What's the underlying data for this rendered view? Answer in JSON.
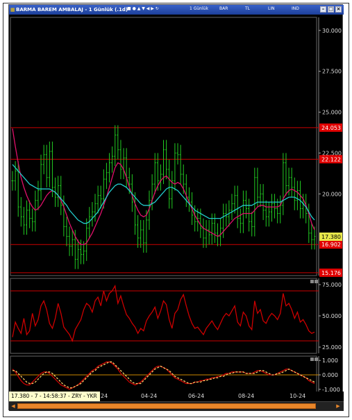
{
  "window": {
    "title": "BARMA BAREM AMBALAJ - 1 Günlük (.1d)",
    "toolbar_items": [
      "1 Günlük",
      "BAR",
      "TL",
      "LIN",
      "IND"
    ]
  },
  "status": {
    "text": "17.380 - 7 - 14:58:37 - ZRY - YKR",
    "x_ticks": [
      "24",
      "04-24",
      "06-24",
      "08-24",
      "10-24"
    ]
  },
  "colors": {
    "background": "#000000",
    "candle": "#22cc22",
    "ma_fast": "#e0106a",
    "ma_slow": "#22cccc",
    "hline": "#cc0000",
    "rsi": "#cc0000",
    "macd": "#cc0000",
    "signal": "#ffcc66",
    "last_price_bg": "#e8e84a"
  },
  "chart_data": [
    {
      "type": "line",
      "panel": "price",
      "ylim": [
        15.0,
        30.8
      ],
      "y_ticks": [
        "30.000",
        "27.500",
        "25.000",
        "22.500",
        "20.000"
      ],
      "horizontal_levels": [
        {
          "label": "24.053",
          "value": 24.053
        },
        {
          "label": "22.122",
          "value": 22.122
        },
        {
          "label": "16.902",
          "value": 16.902
        },
        {
          "label": "15.176",
          "value": 15.176
        }
      ],
      "last_price": {
        "label": "17.380",
        "value": 17.38
      },
      "candles": {
        "x": [
          0,
          4,
          8,
          12,
          16,
          20,
          24,
          28,
          32,
          36,
          40,
          44,
          48,
          52,
          56,
          60,
          64,
          68,
          72,
          76,
          80,
          84,
          88,
          92,
          96,
          100,
          104,
          108,
          112,
          116,
          120,
          124,
          128,
          132,
          136,
          140,
          144,
          148,
          152,
          156,
          160,
          164,
          168,
          172,
          176,
          180,
          184,
          188,
          192,
          196,
          200,
          204,
          208,
          212,
          216,
          220,
          224,
          228,
          232,
          236,
          240,
          244,
          248,
          252,
          256,
          260,
          264,
          268,
          272,
          276,
          280,
          284,
          288,
          292,
          296,
          300,
          304,
          308,
          312,
          316,
          320,
          324,
          328,
          332,
          336,
          340,
          344,
          348,
          352,
          356,
          360,
          364,
          368,
          372,
          376,
          380,
          384,
          388,
          392,
          396,
          400,
          404,
          408,
          412,
          416,
          420,
          424
        ],
        "close": [
          20.8,
          21.4,
          19.2,
          18.6,
          18.1,
          19.0,
          18.5,
          18.3,
          19.6,
          20.2,
          21.8,
          22.4,
          21.0,
          22.6,
          20.4,
          19.8,
          20.5,
          19.3,
          18.0,
          17.4,
          16.8,
          17.2,
          16.0,
          16.6,
          16.3,
          16.5,
          17.9,
          18.6,
          18.9,
          19.4,
          19.9,
          19.7,
          20.9,
          21.3,
          21.9,
          22.3,
          23.6,
          22.7,
          21.5,
          22.2,
          21.0,
          20.6,
          19.5,
          18.1,
          17.3,
          17.8,
          17.0,
          18.4,
          19.6,
          20.6,
          21.9,
          20.8,
          21.2,
          22.7,
          21.5,
          19.7,
          20.8,
          22.5,
          22.4,
          21.2,
          20.6,
          19.8,
          19.5,
          18.7,
          18.3,
          18.5,
          17.9,
          17.3,
          17.8,
          17.5,
          18.2,
          17.6,
          17.4,
          17.9,
          18.8,
          18.6,
          19.0,
          19.4,
          19.9,
          18.5,
          18.2,
          19.6,
          19.1,
          18.3,
          18.0,
          21.0,
          19.8,
          20.0,
          19.0,
          18.6,
          18.9,
          19.4,
          19.1,
          18.8,
          19.3,
          21.9,
          20.5,
          21.0,
          20.4,
          19.6,
          20.2,
          19.1,
          19.4,
          18.8,
          17.6,
          17.2,
          17.4
        ],
        "amplitude": 0.6
      },
      "series": [
        {
          "role": "ma_fast",
          "values": [
            24.0,
            22.9,
            21.9,
            21.0,
            20.4,
            19.9,
            19.5,
            19.2,
            19.0,
            19.1,
            19.3,
            19.6,
            19.9,
            20.1,
            20.2,
            20.1,
            19.9,
            19.6,
            19.2,
            18.7,
            18.2,
            17.8,
            17.4,
            17.1,
            16.9,
            16.9,
            17.0,
            17.3,
            17.6,
            18.0,
            18.4,
            18.8,
            19.3,
            19.8,
            20.4,
            21.0,
            21.6,
            21.9,
            21.8,
            21.5,
            21.0,
            20.4,
            19.9,
            19.4,
            19.0,
            18.7,
            18.6,
            18.7,
            19.1,
            19.6,
            20.1,
            20.5,
            20.8,
            21.0,
            21.1,
            20.9,
            20.7,
            20.6,
            20.7,
            20.6,
            20.3,
            19.9,
            19.5,
            19.1,
            18.7,
            18.4,
            18.1,
            17.9,
            17.8,
            17.7,
            17.6,
            17.5,
            17.4,
            17.5,
            17.7,
            17.9,
            18.1,
            18.3,
            18.5,
            18.6,
            18.7,
            18.8,
            18.8,
            18.8,
            18.8,
            19.0,
            19.2,
            19.3,
            19.3,
            19.2,
            19.2,
            19.2,
            19.2,
            19.2,
            19.3,
            19.7,
            20.0,
            20.2,
            20.3,
            20.2,
            20.1,
            19.9,
            19.7,
            19.3,
            18.8,
            18.2,
            17.8
          ]
        },
        {
          "role": "ma_slow",
          "values": [
            21.8,
            21.6,
            21.4,
            21.2,
            21.0,
            20.8,
            20.6,
            20.5,
            20.4,
            20.3,
            20.3,
            20.3,
            20.3,
            20.3,
            20.2,
            20.1,
            19.9,
            19.7,
            19.5,
            19.3,
            19.0,
            18.8,
            18.6,
            18.4,
            18.3,
            18.2,
            18.2,
            18.3,
            18.5,
            18.7,
            18.9,
            19.2,
            19.5,
            19.8,
            20.1,
            20.3,
            20.5,
            20.6,
            20.6,
            20.5,
            20.4,
            20.2,
            20.0,
            19.8,
            19.6,
            19.4,
            19.3,
            19.3,
            19.3,
            19.4,
            19.5,
            19.7,
            19.9,
            20.1,
            20.3,
            20.4,
            20.4,
            20.3,
            20.2,
            20.0,
            19.8,
            19.6,
            19.4,
            19.2,
            19.0,
            18.9,
            18.8,
            18.7,
            18.6,
            18.5,
            18.5,
            18.5,
            18.5,
            18.5,
            18.6,
            18.7,
            18.8,
            18.9,
            19.0,
            19.1,
            19.2,
            19.3,
            19.3,
            19.3,
            19.3,
            19.4,
            19.5,
            19.5,
            19.5,
            19.5,
            19.5,
            19.5,
            19.5,
            19.5,
            19.5,
            19.6,
            19.7,
            19.8,
            19.8,
            19.8,
            19.7,
            19.6,
            19.4,
            19.2,
            18.9,
            18.6,
            18.4
          ]
        }
      ]
    },
    {
      "type": "line",
      "panel": "oscillator",
      "ylim": [
        20.0,
        80.0
      ],
      "y_ticks": [
        "75.000",
        "50.000",
        "25.000"
      ],
      "horizontal_levels": [
        {
          "value": 70
        },
        {
          "value": 30
        }
      ],
      "series": [
        {
          "role": "rsi",
          "values": [
            33,
            45,
            40,
            36,
            48,
            35,
            38,
            52,
            42,
            47,
            58,
            62,
            55,
            44,
            40,
            48,
            60,
            52,
            41,
            38,
            35,
            30,
            39,
            43,
            47,
            55,
            60,
            58,
            53,
            62,
            65,
            58,
            70,
            62,
            68,
            70,
            74,
            60,
            66,
            58,
            51,
            48,
            44,
            41,
            36,
            40,
            38,
            46,
            50,
            53,
            57,
            48,
            54,
            62,
            59,
            47,
            40,
            52,
            55,
            63,
            67,
            58,
            50,
            44,
            40,
            41,
            38,
            35,
            40,
            43,
            46,
            42,
            39,
            44,
            49,
            52,
            50,
            54,
            58,
            45,
            42,
            53,
            50,
            42,
            39,
            62,
            52,
            55,
            46,
            44,
            49,
            52,
            50,
            47,
            52,
            68,
            58,
            60,
            55,
            48,
            53,
            45,
            47,
            43,
            38,
            36,
            37
          ]
        }
      ]
    },
    {
      "type": "line",
      "panel": "oscillator2",
      "ylim": [
        -1.3,
        1.3
      ],
      "y_ticks": [
        "1.000",
        "0.000",
        "-1.000"
      ],
      "horizontal_levels": [
        {
          "value": 0
        }
      ],
      "series": [
        {
          "role": "macd",
          "values": [
            0.4,
            0.2,
            -0.1,
            -0.4,
            -0.6,
            -0.7,
            -0.7,
            -0.5,
            -0.3,
            -0.1,
            0.1,
            0.2,
            0.2,
            0.1,
            -0.1,
            -0.3,
            -0.5,
            -0.7,
            -0.8,
            -0.9,
            -1.0,
            -0.9,
            -0.8,
            -0.7,
            -0.5,
            -0.3,
            -0.1,
            0.1,
            0.3,
            0.4,
            0.6,
            0.7,
            0.8,
            0.9,
            0.9,
            0.8,
            0.6,
            0.4,
            0.1,
            -0.1,
            -0.3,
            -0.5,
            -0.6,
            -0.7,
            -0.6,
            -0.5,
            -0.3,
            -0.1,
            0.1,
            0.3,
            0.5,
            0.6,
            0.6,
            0.5,
            0.4,
            0.2,
            0.0,
            -0.2,
            -0.3,
            -0.4,
            -0.5,
            -0.6,
            -0.6,
            -0.6,
            -0.5,
            -0.5,
            -0.4,
            -0.4,
            -0.3,
            -0.3,
            -0.2,
            -0.2,
            -0.1,
            -0.1,
            0.0,
            0.1,
            0.1,
            0.2,
            0.2,
            0.2,
            0.2,
            0.2,
            0.1,
            0.1,
            0.1,
            0.2,
            0.3,
            0.3,
            0.2,
            0.1,
            0.0,
            0.0,
            0.0,
            0.1,
            0.2,
            0.3,
            0.4,
            0.4,
            0.3,
            0.2,
            0.1,
            0.0,
            -0.1,
            -0.2,
            -0.4,
            -0.5,
            -0.6
          ]
        },
        {
          "role": "signal",
          "values": [
            0.3,
            0.3,
            0.1,
            -0.1,
            -0.3,
            -0.5,
            -0.6,
            -0.6,
            -0.5,
            -0.3,
            -0.1,
            0.1,
            0.2,
            0.2,
            0.1,
            -0.1,
            -0.3,
            -0.5,
            -0.7,
            -0.8,
            -0.9,
            -0.9,
            -0.8,
            -0.7,
            -0.6,
            -0.4,
            -0.2,
            0.0,
            0.2,
            0.3,
            0.5,
            0.6,
            0.7,
            0.8,
            0.9,
            0.9,
            0.7,
            0.5,
            0.3,
            0.1,
            -0.1,
            -0.3,
            -0.5,
            -0.6,
            -0.6,
            -0.6,
            -0.4,
            -0.2,
            0.0,
            0.2,
            0.4,
            0.5,
            0.6,
            0.5,
            0.4,
            0.3,
            0.1,
            -0.1,
            -0.2,
            -0.3,
            -0.4,
            -0.5,
            -0.6,
            -0.6,
            -0.5,
            -0.5,
            -0.5,
            -0.4,
            -0.4,
            -0.3,
            -0.3,
            -0.2,
            -0.2,
            -0.1,
            -0.1,
            0.0,
            0.1,
            0.1,
            0.2,
            0.2,
            0.2,
            0.2,
            0.1,
            0.1,
            0.1,
            0.1,
            0.2,
            0.3,
            0.3,
            0.2,
            0.1,
            0.0,
            0.0,
            0.1,
            0.1,
            0.2,
            0.3,
            0.4,
            0.3,
            0.2,
            0.1,
            0.0,
            -0.1,
            -0.2,
            -0.3,
            -0.4,
            -0.5
          ]
        }
      ]
    }
  ]
}
